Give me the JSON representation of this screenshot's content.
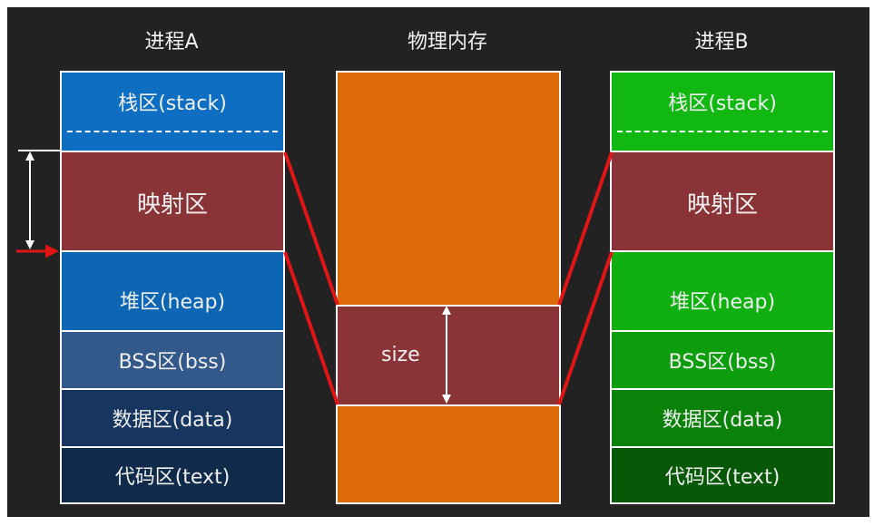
{
  "columns": {
    "process_a": {
      "title": "进程A",
      "stack": "栈区(stack)",
      "mapping": "映射区",
      "heap": "堆区(heap)",
      "bss": "BSS区(bss)",
      "data": "数据区(data)",
      "text": "代码区(text)"
    },
    "physical": {
      "title": "物理内存",
      "size_label": "size"
    },
    "process_b": {
      "title": "进程B",
      "stack": "栈区(stack)",
      "mapping": "映射区",
      "heap": "堆区(heap)",
      "bss": "BSS区(bss)",
      "data": "数据区(data)",
      "text": "代码区(text)"
    }
  },
  "colors": {
    "background": "#222222",
    "mapping": "#8b3438",
    "a_stack": "#0e6fc2",
    "a_heap": "#0c66b4",
    "a_bss": "#33588a",
    "a_data": "#16365f",
    "a_text": "#102a49",
    "physical": "#de6b0a",
    "b_stack": "#12b812",
    "b_heap": "#10b010",
    "b_bss": "#0d9e0d",
    "b_data": "#0a820a",
    "b_text": "#075907",
    "connector": "#e01616"
  }
}
